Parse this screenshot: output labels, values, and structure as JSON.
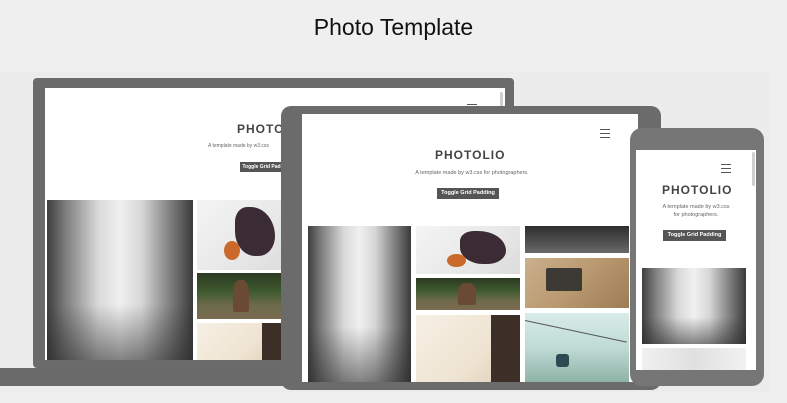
{
  "page": {
    "title": "Photo Template"
  },
  "app": {
    "brand": "PHOTOLIO",
    "tagline": "A template made by w3.css for photographers.",
    "tagline_phone_line1": "A template made by w3.css",
    "tagline_phone_line2": "for photographers.",
    "toggle_label": "Toggle Grid Padding",
    "brand_truncated": "PHOTO",
    "tagline_truncated": "A template made by w3.css",
    "toggle_truncated": "Toggle Grid Padd",
    "menu_icon": "hamburger-menu-icon"
  },
  "colors": {
    "background": "#efefef",
    "device_frame": "#6b6b6b",
    "button": "#555555",
    "brand_text": "#444444"
  }
}
